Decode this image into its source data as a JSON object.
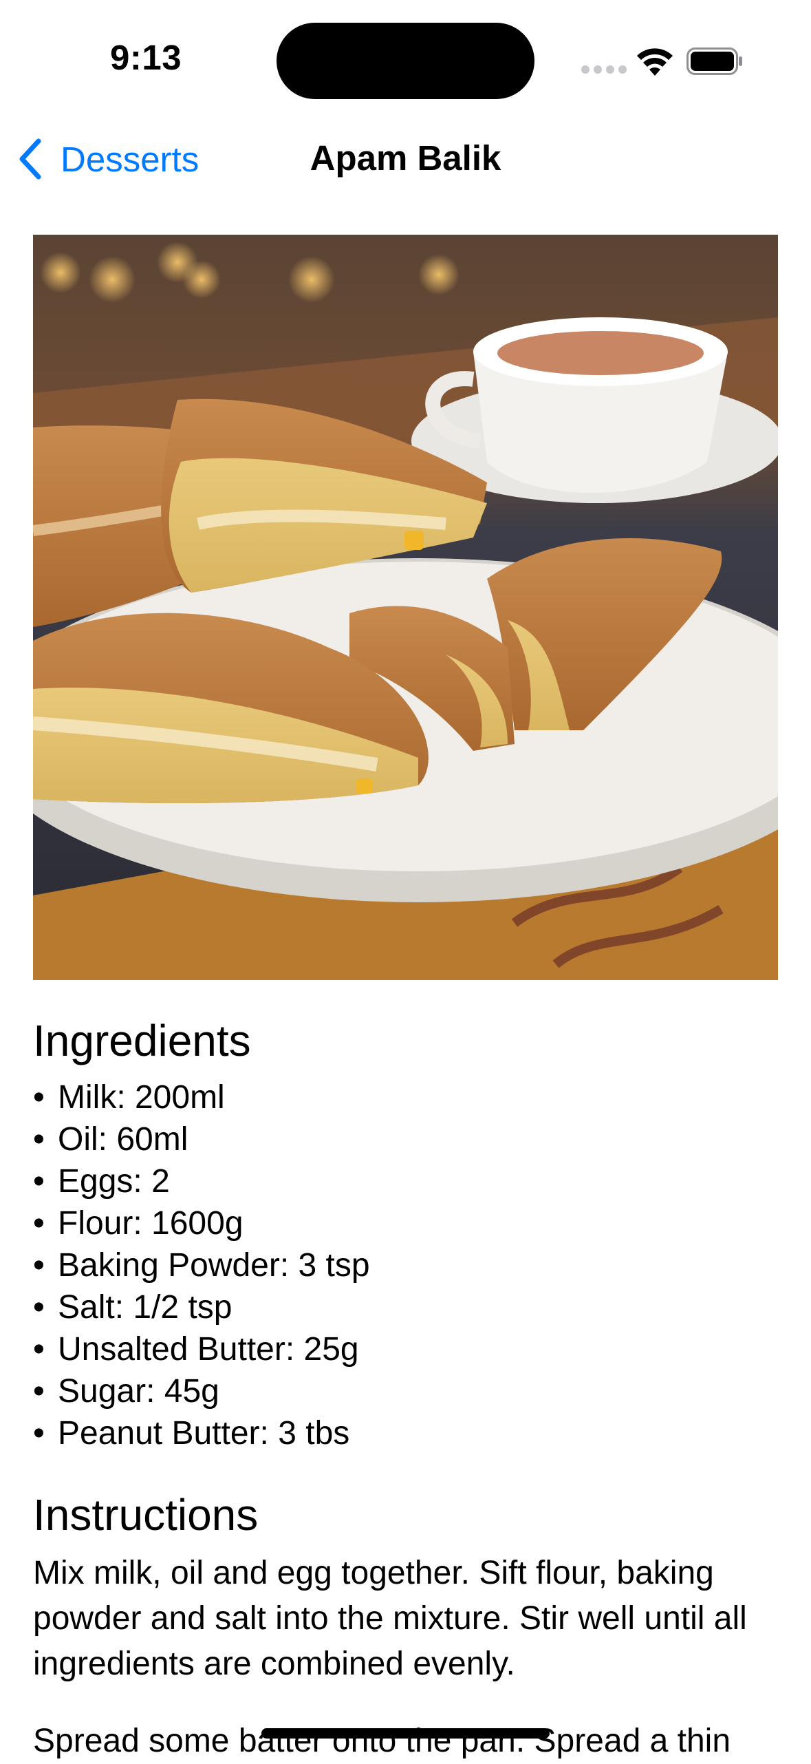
{
  "status_bar": {
    "time": "9:13"
  },
  "nav": {
    "back_label": "Desserts",
    "title": "Apam Balik"
  },
  "hero": {
    "alt": "Apam Balik"
  },
  "ingredients": {
    "heading": "Ingredients",
    "bullet": "•",
    "items": [
      "Milk: 200ml",
      "Oil: 60ml",
      "Eggs: 2",
      "Flour: 1600g",
      "Baking Powder: 3 tsp",
      "Salt: 1/2 tsp",
      "Unsalted Butter: 25g",
      "Sugar: 45g",
      "Peanut Butter: 3 tbs"
    ]
  },
  "instructions": {
    "heading": "Instructions",
    "paragraph_1": "Mix milk, oil and egg together. Sift flour, baking powder and salt into the mixture. Stir well until all ingredients are combined evenly.",
    "paragraph_2": "Spread some batter onto the pan. Spread a thin"
  },
  "colors": {
    "accent": "#007aff",
    "text": "#000000",
    "background": "#ffffff"
  }
}
